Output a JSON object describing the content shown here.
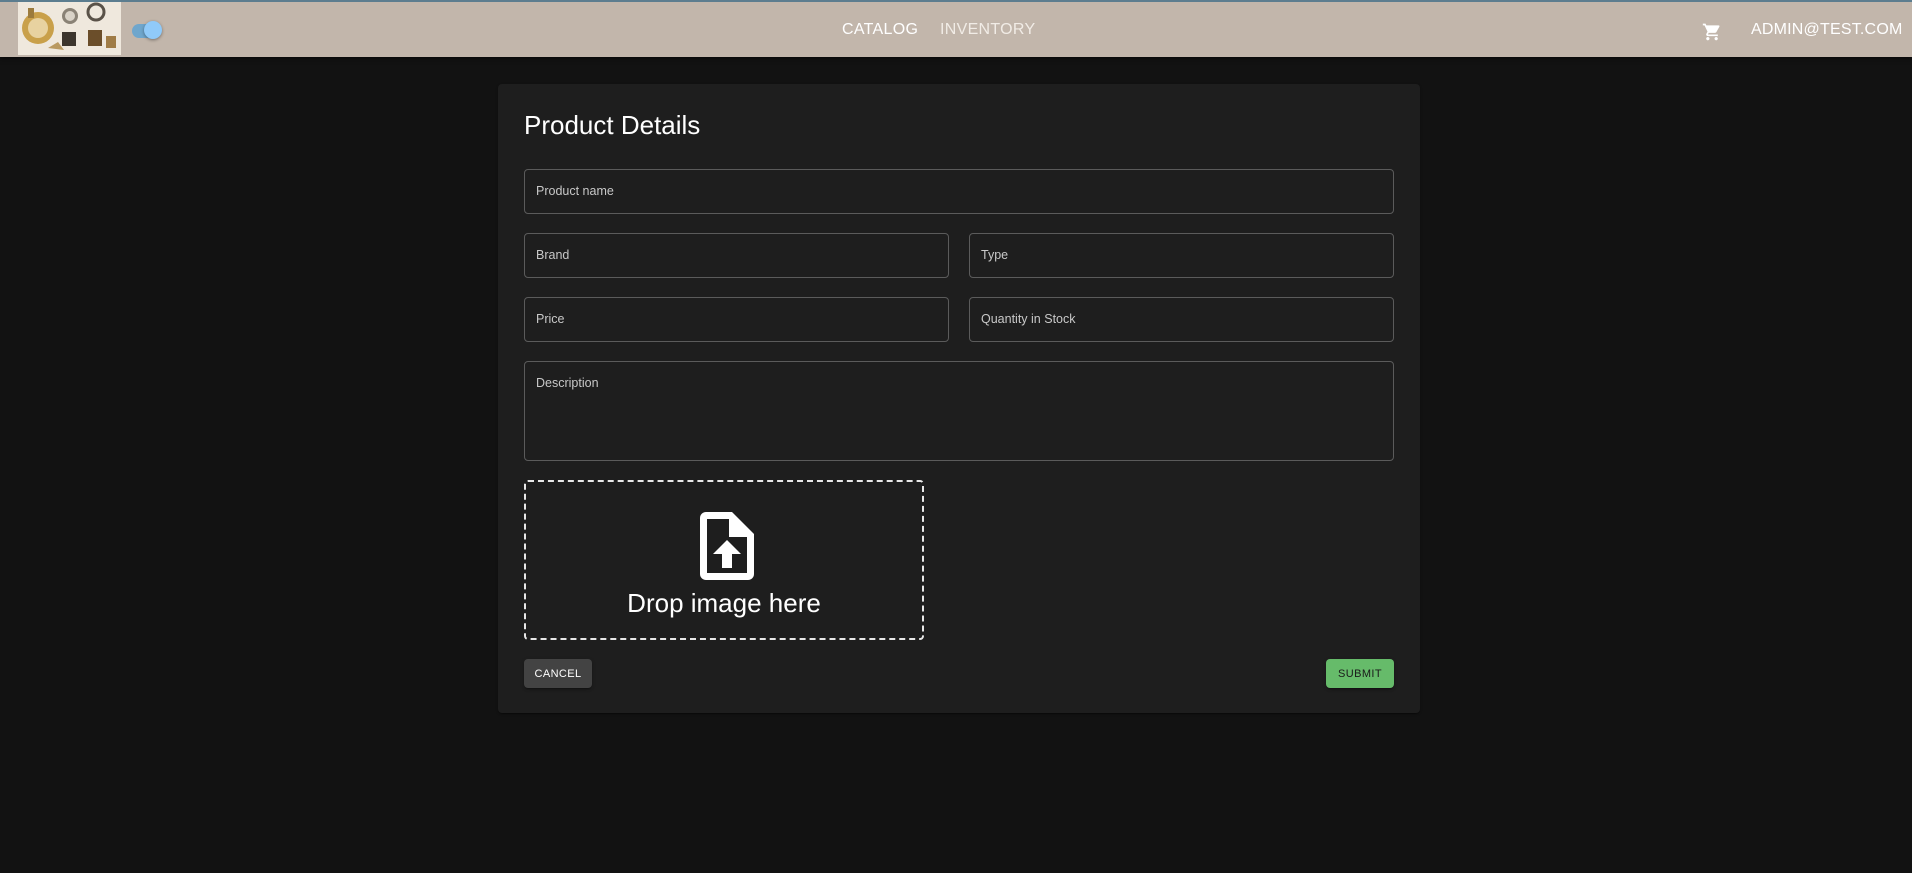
{
  "header": {
    "nav": [
      {
        "label": "CATALOG"
      },
      {
        "label": "INVENTORY"
      }
    ],
    "cart_icon": "shopping-cart-icon",
    "user_email": "ADMIN@TEST.COM",
    "logo_icon": "shop-logo",
    "theme_toggle": {
      "state": "on",
      "color": "#90caf9"
    }
  },
  "form": {
    "title": "Product Details",
    "fields": {
      "product_name": {
        "label": "Product name",
        "value": ""
      },
      "brand": {
        "label": "Brand",
        "value": ""
      },
      "type": {
        "label": "Type",
        "value": ""
      },
      "price": {
        "label": "Price",
        "value": ""
      },
      "quantity": {
        "label": "Quantity in Stock",
        "value": ""
      },
      "description": {
        "label": "Description",
        "value": ""
      }
    },
    "dropzone": {
      "text": "Drop image here",
      "icon": "file-upload-icon"
    },
    "cancel_label": "Cancel",
    "submit_label": "Submit"
  },
  "colors": {
    "appbar": "#c2b6ab",
    "background": "#121212",
    "card": "#1e1e1e",
    "submit": "#66bb6a",
    "cancel": "#434343"
  }
}
